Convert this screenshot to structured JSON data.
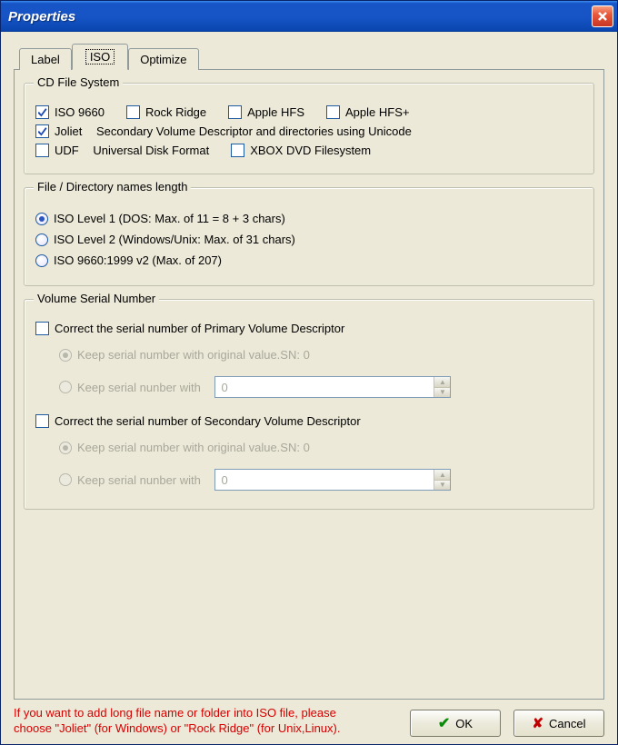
{
  "window": {
    "title": "Properties"
  },
  "tabs": {
    "label": "Label",
    "iso": "ISO",
    "optimize": "Optimize",
    "active": "iso"
  },
  "group_fs": {
    "title": "CD File System",
    "iso9660": "ISO 9660",
    "rockridge": "Rock Ridge",
    "applehfs": "Apple HFS",
    "applehfsplus": "Apple HFS+",
    "joliet": "Joliet",
    "joliet_desc": "Secondary Volume Descriptor and directories using Unicode",
    "udf": "UDF",
    "udf_desc": "Universal Disk Format",
    "xbox": "XBOX DVD Filesystem",
    "checked": {
      "iso9660": true,
      "rockridge": false,
      "applehfs": false,
      "applehfsplus": false,
      "joliet": true,
      "udf": false,
      "xbox": false
    }
  },
  "group_len": {
    "title": "File / Directory names  length",
    "lvl1": "ISO Level 1 (DOS: Max. of 11 = 8 + 3 chars)",
    "lvl2": "ISO Level 2 (Windows/Unix: Max. of 31 chars)",
    "lvl3": "ISO 9660:1999 v2 (Max. of 207)",
    "selected": "lvl1"
  },
  "group_vsn": {
    "title": "Volume Serial Number",
    "correct_primary": "Correct the serial number of  Primary Volume Descriptor",
    "keep_original": "Keep serial number with original value.SN: 0",
    "keep_with": "Keep serial nunber with",
    "correct_secondary": "Correct the serial number of  Secondary Volume Descriptor",
    "spin1_value": "0",
    "spin2_value": "0"
  },
  "hint": "If you want to add long file name or folder into ISO file, please choose \"Joliet\" (for Windows) or \"Rock Ridge\" (for Unix,Linux).",
  "buttons": {
    "ok": "OK",
    "cancel": "Cancel"
  }
}
